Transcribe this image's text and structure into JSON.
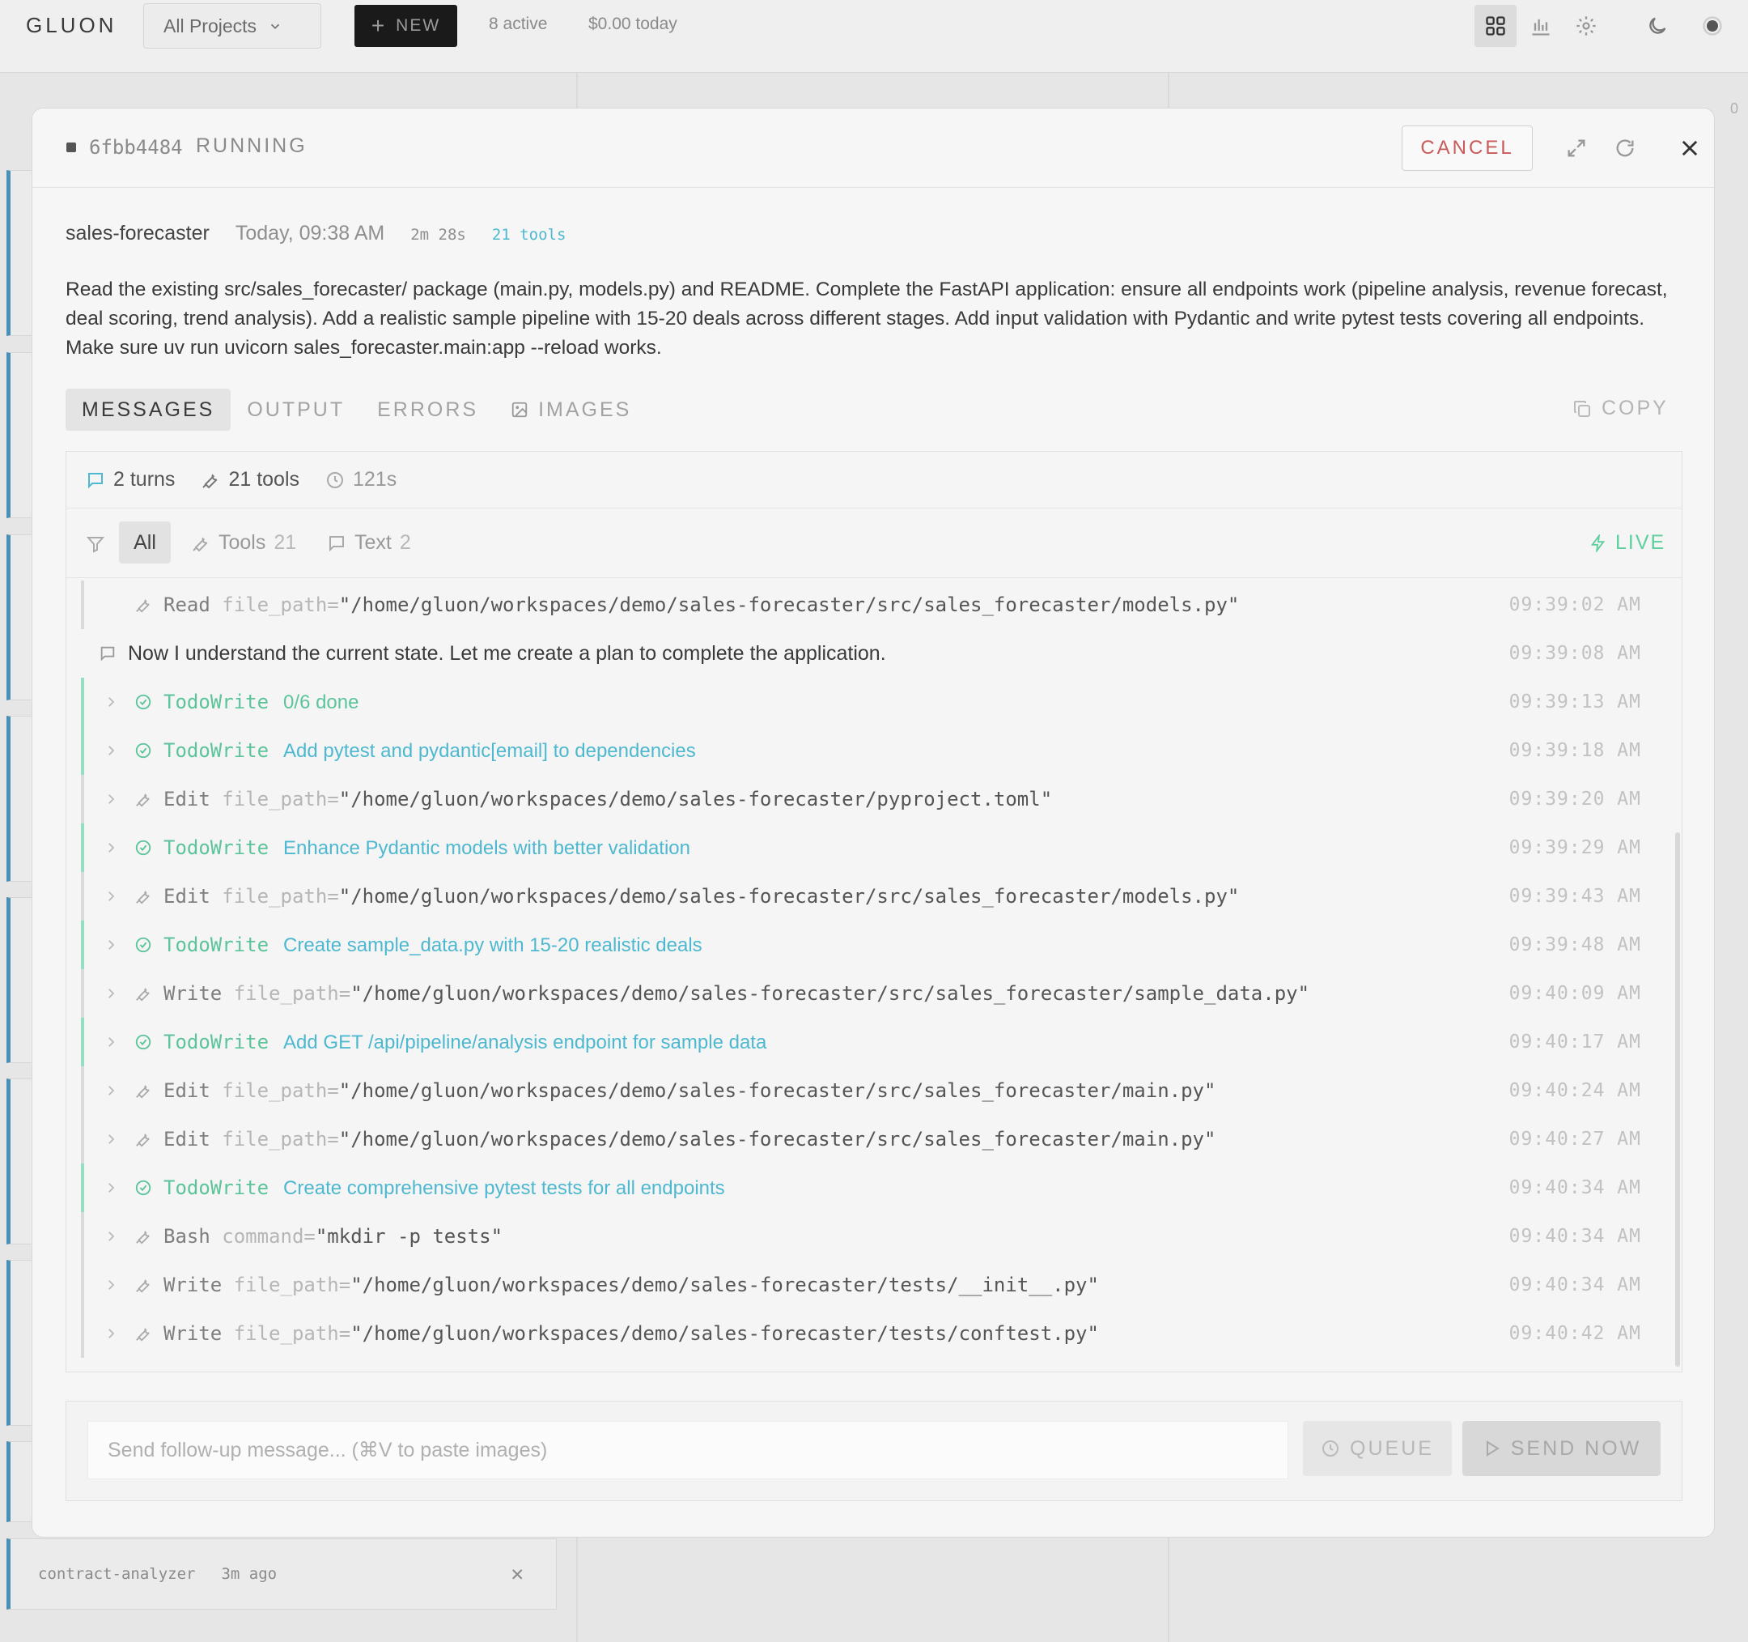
{
  "app": {
    "logo": "GLUON",
    "project_select": "All Projects",
    "new_label": "NEW",
    "active_count": "8 active",
    "cost_today": "$0.00 today"
  },
  "board": {
    "count_active": "0",
    "last_card": {
      "name": "contract-analyzer",
      "ago": "3m ago"
    }
  },
  "modal": {
    "task_id": "6fbb4484",
    "status": "RUNNING",
    "cancel_label": "CANCEL",
    "project": "sales-forecaster",
    "started": "Today, 09:38 AM",
    "duration": "2m 28s",
    "tools_badge": "21 tools",
    "prompt": "Read the existing src/sales_forecaster/ package (main.py, models.py) and README. Complete the FastAPI application: ensure all endpoints work (pipeline analysis, revenue forecast, deal scoring, trend analysis). Add a realistic sample pipeline with 15-20 deals across different stages. Add input validation with Pydantic and write pytest tests covering all endpoints. Make sure uv run uvicorn sales_forecaster.main:app --reload works.",
    "tabs": [
      "MESSAGES",
      "OUTPUT",
      "ERRORS",
      "IMAGES"
    ],
    "copy_label": "COPY",
    "stats": {
      "turns": "2 turns",
      "tools": "21 tools",
      "time": "121s"
    },
    "filters": {
      "all": "All",
      "tools_label": "Tools",
      "tools_count": "21",
      "text_label": "Text",
      "text_count": "2",
      "live": "LIVE"
    },
    "log": [
      {
        "kind": "tool",
        "expandable": false,
        "tool": "Read",
        "key": "file_path=",
        "value": "\"/home/gluon/workspaces/demo/sales-forecaster/src/sales_forecaster/models.py\"",
        "time": "09:39:02 AM"
      },
      {
        "kind": "text",
        "text": "Now I understand the current state. Let me create a plan to complete the application.",
        "time": "09:39:08 AM"
      },
      {
        "kind": "todo",
        "tool": "TodoWrite",
        "text": "0/6 done",
        "time": "09:39:13 AM"
      },
      {
        "kind": "todo",
        "tool": "TodoWrite",
        "text": "Add pytest and pydantic[email] to dependencies",
        "time": "09:39:18 AM"
      },
      {
        "kind": "tool",
        "tool": "Edit",
        "key": "file_path=",
        "value": "\"/home/gluon/workspaces/demo/sales-forecaster/pyproject.toml\"",
        "time": "09:39:20 AM"
      },
      {
        "kind": "todo",
        "tool": "TodoWrite",
        "text": "Enhance Pydantic models with better validation",
        "time": "09:39:29 AM"
      },
      {
        "kind": "tool",
        "tool": "Edit",
        "key": "file_path=",
        "value": "\"/home/gluon/workspaces/demo/sales-forecaster/src/sales_forecaster/models.py\"",
        "time": "09:39:43 AM"
      },
      {
        "kind": "todo",
        "tool": "TodoWrite",
        "text": "Create sample_data.py with 15-20 realistic deals",
        "time": "09:39:48 AM"
      },
      {
        "kind": "tool",
        "tool": "Write",
        "key": "file_path=",
        "value": "\"/home/gluon/workspaces/demo/sales-forecaster/src/sales_forecaster/sample_data.py\"",
        "time": "09:40:09 AM"
      },
      {
        "kind": "todo",
        "tool": "TodoWrite",
        "text": "Add GET /api/pipeline/analysis endpoint for sample data",
        "time": "09:40:17 AM"
      },
      {
        "kind": "tool",
        "tool": "Edit",
        "key": "file_path=",
        "value": "\"/home/gluon/workspaces/demo/sales-forecaster/src/sales_forecaster/main.py\"",
        "time": "09:40:24 AM"
      },
      {
        "kind": "tool",
        "tool": "Edit",
        "key": "file_path=",
        "value": "\"/home/gluon/workspaces/demo/sales-forecaster/src/sales_forecaster/main.py\"",
        "time": "09:40:27 AM"
      },
      {
        "kind": "todo",
        "tool": "TodoWrite",
        "text": "Create comprehensive pytest tests for all endpoints",
        "time": "09:40:34 AM"
      },
      {
        "kind": "tool",
        "tool": "Bash",
        "key": "command=",
        "value": "\"mkdir -p tests\"",
        "time": "09:40:34 AM"
      },
      {
        "kind": "tool",
        "tool": "Write",
        "key": "file_path=",
        "value": "\"/home/gluon/workspaces/demo/sales-forecaster/tests/__init__.py\"",
        "time": "09:40:34 AM"
      },
      {
        "kind": "tool",
        "tool": "Write",
        "key": "file_path=",
        "value": "\"/home/gluon/workspaces/demo/sales-forecaster/tests/conftest.py\"",
        "time": "09:40:42 AM"
      }
    ],
    "compose": {
      "placeholder": "Send follow-up message... (⌘V to paste images)",
      "queue_label": "QUEUE",
      "send_label": "SEND NOW"
    }
  },
  "colors": {
    "accent_green": "#5cc49a",
    "accent_teal": "#4db8cf",
    "cancel_red": "#c95a5a",
    "card_rail": "#4a8fb8"
  }
}
